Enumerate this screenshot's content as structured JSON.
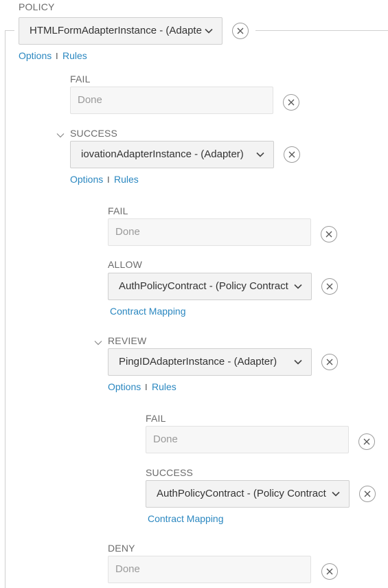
{
  "policy": {
    "heading": "POLICY",
    "select_value": "HTMLFormAdapterInstance - (Adapte",
    "options_link": "Options",
    "separator": "I",
    "rules_link": "Rules",
    "fail": {
      "label": "FAIL",
      "value": "Done"
    },
    "success": {
      "label": "SUCCESS",
      "select_value": "iovationAdapterInstance - (Adapter)",
      "options_link": "Options",
      "separator": "I",
      "rules_link": "Rules",
      "fail": {
        "label": "FAIL",
        "value": "Done"
      },
      "allow": {
        "label": "ALLOW",
        "select_value": "AuthPolicyContract - (Policy Contract",
        "contract_mapping_link": "Contract Mapping"
      },
      "review": {
        "label": "REVIEW",
        "select_value": "PingIDAdapterInstance - (Adapter)",
        "options_link": "Options",
        "separator": "I",
        "rules_link": "Rules",
        "fail": {
          "label": "FAIL",
          "value": "Done"
        },
        "success": {
          "label": "SUCCESS",
          "select_value": "AuthPolicyContract - (Policy Contract",
          "contract_mapping_link": "Contract Mapping"
        }
      },
      "deny": {
        "label": "DENY",
        "value": "Done"
      }
    }
  },
  "icons": {
    "chevron": "chevron-down-icon",
    "remove": "close-icon",
    "collapse": "collapse-toggle-icon"
  },
  "colors": {
    "link": "#2a87c0",
    "label": "#6b6b6b",
    "tree_line": "#cfcfcf"
  }
}
